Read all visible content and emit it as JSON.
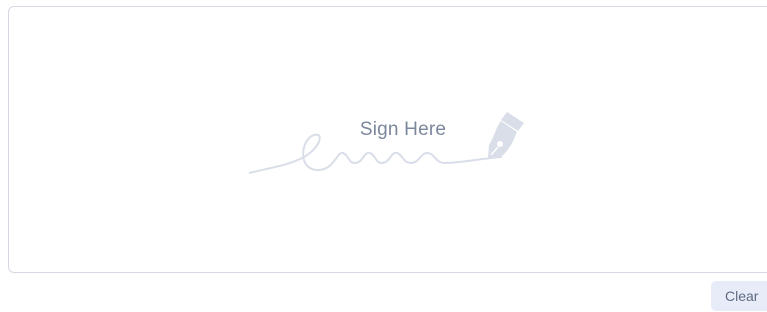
{
  "signature_pad": {
    "placeholder_text": "Sign Here",
    "signature_icon": "signature-squiggle-icon",
    "pen_icon": "fountain-pen-nib-icon"
  },
  "actions": {
    "clear_label": "Clear"
  },
  "colors": {
    "pad_border": "#d5d9e2",
    "placeholder_text": "#7b879b",
    "placeholder_art": "#d9dee8",
    "clear_button_bg": "#e8ecf8",
    "clear_button_text": "#5f6b80"
  }
}
